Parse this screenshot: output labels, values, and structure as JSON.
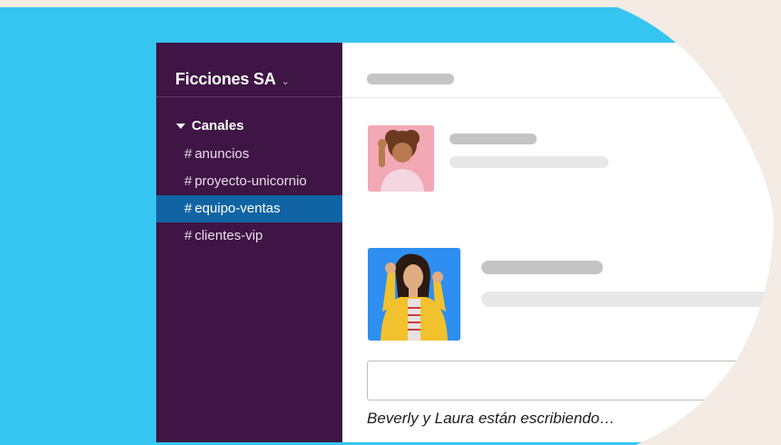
{
  "workspace": {
    "name": "Ficciones SA",
    "chevron_icon": "chevron-down-icon"
  },
  "sidebar": {
    "section_label": "Canales",
    "channels": [
      {
        "prefix": "#",
        "name": "anuncios"
      },
      {
        "prefix": "#",
        "name": "proyecto-unicornio"
      },
      {
        "prefix": "#",
        "name": "equipo-ventas",
        "active": true
      },
      {
        "prefix": "#",
        "name": "clientes-vip"
      }
    ]
  },
  "messages": [
    {
      "avatar": "woman-waving-avatar",
      "avatar_bg": "#f3a9b5"
    },
    {
      "avatar": "woman-yellow-jacket-avatar",
      "avatar_bg": "#2f8ff0"
    }
  ],
  "typing_indicator": "Beverly y Laura están escribiendo…",
  "colors": {
    "backdrop": "#36c5f0",
    "sidebar": "#3f1545",
    "active_channel": "#1164a3",
    "page": "#f3ebe4"
  }
}
